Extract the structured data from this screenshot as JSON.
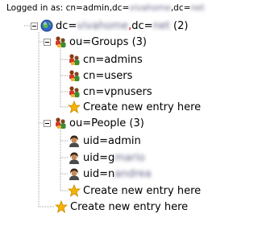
{
  "header": {
    "prefix": "Logged in as: cn=admin,dc=",
    "blur1": "vivahome",
    "middle": ",dc=",
    "blur2": "net"
  },
  "tree": {
    "root": {
      "prefix": "dc=",
      "blur1": "vivahome",
      "comma": ",",
      "middle": "dc=",
      "blur2": "net",
      "count": "(2)"
    },
    "groups": {
      "label": "ou=Groups (3)",
      "children": [
        "cn=admins",
        "cn=users",
        "cn=vpnusers"
      ],
      "create": "Create new entry here"
    },
    "people": {
      "label": "ou=People (3)",
      "admin": "uid=admin",
      "user2_prefix": "uid=g",
      "user2_blur": "mario",
      "user3_prefix": "uid=n",
      "user3_blur": "andrea",
      "create": "Create new entry here"
    },
    "root_create": "Create new entry here"
  },
  "colors": {
    "tree_line": "#a0a0a0",
    "expander_border": "#919191",
    "comma_red": "#d40000"
  },
  "icons": {
    "root": "globe-icon",
    "ou": "folder-people-icon",
    "group": "group-icon",
    "user": "user-avatar-icon",
    "create": "star-icon"
  }
}
